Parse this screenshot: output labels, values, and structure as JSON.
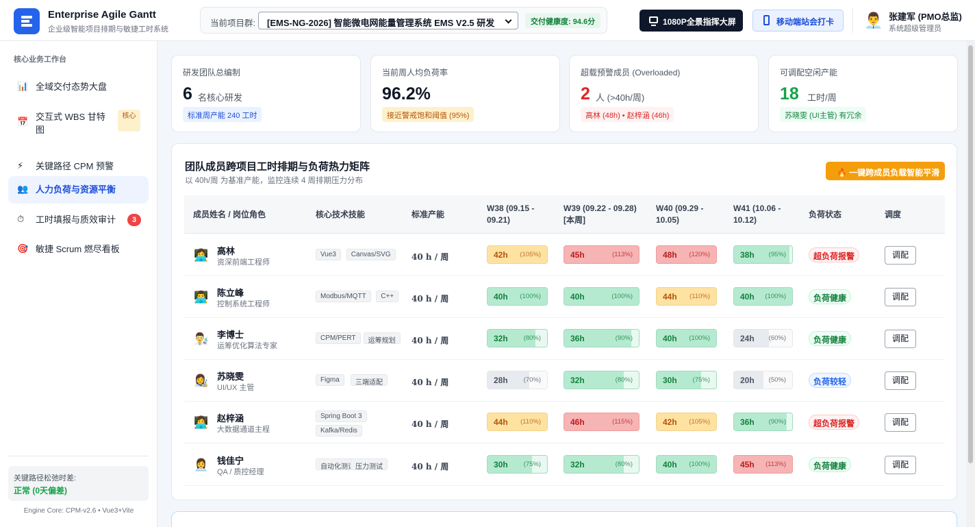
{
  "app": {
    "name": "Enterprise Agile Gantt",
    "subtitle": "企业级智能项目排期与敏捷工时系统"
  },
  "project": {
    "label": "当前项目群:",
    "selected": "[EMS-NG-2026] 智能微电网能量管理系统 EMS V2.5 研发",
    "health": "交付健康度: 94.6分"
  },
  "actions": {
    "bigscreen": "1080P全景指挥大屏",
    "mobile": "移动端站会打卡"
  },
  "user": {
    "avatar": "👨‍💼",
    "name": "张建军 (PMO总监)",
    "role": "系统超级管理员"
  },
  "sidebar": {
    "heading": "核心业务工作台",
    "items": [
      {
        "icon": "📊",
        "label": "全域交付态势大盘"
      },
      {
        "icon": "📅",
        "label": "交互式 WBS 甘特图",
        "tag": "核心"
      },
      {
        "icon": "⚡",
        "label": "关键路径 CPM 预警"
      },
      {
        "icon": "👥",
        "label": "人力负荷与资源平衡",
        "active": true
      },
      {
        "icon": "⏱",
        "label": "工时填报与质效审计",
        "badge": "3"
      },
      {
        "icon": "🎯",
        "label": "敏捷 Scrum 燃尽看板"
      }
    ],
    "slack_label": "关键路径松弛时差:",
    "slack_value": "正常 (0天偏差)",
    "engine": "Engine Core: CPM-v2.6 • Vue3+Vite"
  },
  "stats": [
    {
      "label": "研发团队总编制",
      "value": "6",
      "unit": "名核心研发",
      "badge": "标准周产能 240 工时",
      "tone": "blue"
    },
    {
      "label": "当前周人均负荷率",
      "value": "96.2%",
      "unit": "",
      "badge": "接近警戒饱和阈值 (95%)",
      "tone": "orange"
    },
    {
      "label": "超载预警成员 (Overloaded)",
      "value": "2",
      "unit": "人 (>40h/周)",
      "badge": "高林 (48h) • 赵梓涵 (46h)",
      "tone": "red"
    },
    {
      "label": "可调配空闲产能",
      "value": "18",
      "unit": "工时/周",
      "badge": "苏晓雯 (UI主管) 有冗余",
      "tone": "green"
    }
  ],
  "matrix": {
    "title": "团队成员跨项目工时排期与负荷热力矩阵",
    "subtitle": "以 40h/周 为基准产能，监控连续 4 周排期压力分布",
    "smooth_button": "🔥 一键跨成员负载智能平滑",
    "headers": {
      "member": "成员姓名 / 岗位角色",
      "skills": "核心技术技能",
      "capacity": "标准产能",
      "weeks": [
        "W38 (09.15 - 09.21)",
        "W39 (09.22 - 09.28) [本周]",
        "W40 (09.29 - 10.05)",
        "W41 (10.06 - 10.12)"
      ],
      "status": "负荷状态",
      "action": "调度"
    },
    "rows": [
      {
        "avatar": "👩‍💻",
        "name": "高林",
        "role": "资深前端工程师",
        "skills": [
          "Vue3",
          "Canvas/SVG"
        ],
        "capacity": "40 h / 周",
        "weeks": [
          {
            "h": "42h",
            "p": "(105%)",
            "pct": 105,
            "tone": "o"
          },
          {
            "h": "45h",
            "p": "(113%)",
            "pct": 113,
            "tone": "r"
          },
          {
            "h": "48h",
            "p": "(120%)",
            "pct": 120,
            "tone": "r"
          },
          {
            "h": "38h",
            "p": "(95%)",
            "pct": 95,
            "tone": "g"
          }
        ],
        "status": "超负荷报警",
        "status_tone": "r",
        "action": "调配"
      },
      {
        "avatar": "👨‍💻",
        "name": "陈立峰",
        "role": "控制系统工程师",
        "skills": [
          "Modbus/MQTT",
          "C++"
        ],
        "capacity": "40 h / 周",
        "weeks": [
          {
            "h": "40h",
            "p": "(100%)",
            "pct": 100,
            "tone": "g"
          },
          {
            "h": "40h",
            "p": "(100%)",
            "pct": 100,
            "tone": "g"
          },
          {
            "h": "44h",
            "p": "(110%)",
            "pct": 110,
            "tone": "o"
          },
          {
            "h": "40h",
            "p": "(100%)",
            "pct": 100,
            "tone": "g"
          }
        ],
        "status": "负荷健康",
        "status_tone": "g",
        "action": "调配"
      },
      {
        "avatar": "👨‍🔬",
        "name": "李博士",
        "role": "运筹优化算法专家",
        "skills": [
          "CPM/PERT",
          "运筹规划"
        ],
        "capacity": "40 h / 周",
        "weeks": [
          {
            "h": "32h",
            "p": "(80%)",
            "pct": 80,
            "tone": "g"
          },
          {
            "h": "36h",
            "p": "(90%)",
            "pct": 90,
            "tone": "g"
          },
          {
            "h": "40h",
            "p": "(100%)",
            "pct": 100,
            "tone": "g"
          },
          {
            "h": "24h",
            "p": "(60%)",
            "pct": 60,
            "tone": "n"
          }
        ],
        "status": "负荷健康",
        "status_tone": "g",
        "action": "调配"
      },
      {
        "avatar": "👩‍🎨",
        "name": "苏晓雯",
        "role": "UI/UX 主管",
        "skills": [
          "Figma",
          "三端适配"
        ],
        "capacity": "40 h / 周",
        "weeks": [
          {
            "h": "28h",
            "p": "(70%)",
            "pct": 70,
            "tone": "n"
          },
          {
            "h": "32h",
            "p": "(80%)",
            "pct": 80,
            "tone": "g"
          },
          {
            "h": "30h",
            "p": "(75%)",
            "pct": 75,
            "tone": "g"
          },
          {
            "h": "20h",
            "p": "(50%)",
            "pct": 50,
            "tone": "n"
          }
        ],
        "status": "负荷较轻",
        "status_tone": "b",
        "action": "调配"
      },
      {
        "avatar": "👩‍💻",
        "name": "赵梓涵",
        "role": "大数据通道主程",
        "skills": [
          "Spring Boot 3",
          "Kafka/Redis"
        ],
        "capacity": "40 h / 周",
        "weeks": [
          {
            "h": "44h",
            "p": "(110%)",
            "pct": 110,
            "tone": "o"
          },
          {
            "h": "46h",
            "p": "(115%)",
            "pct": 115,
            "tone": "r"
          },
          {
            "h": "42h",
            "p": "(105%)",
            "pct": 105,
            "tone": "o"
          },
          {
            "h": "36h",
            "p": "(90%)",
            "pct": 90,
            "tone": "g"
          }
        ],
        "status": "超负荷报警",
        "status_tone": "r",
        "action": "调配"
      },
      {
        "avatar": "👩‍💼",
        "name": "钱佳宁",
        "role": "QA / 质控经理",
        "skills": [
          "自动化测试",
          "压力测试"
        ],
        "capacity": "40 h / 周",
        "weeks": [
          {
            "h": "30h",
            "p": "(75%)",
            "pct": 75,
            "tone": "g"
          },
          {
            "h": "32h",
            "p": "(80%)",
            "pct": 80,
            "tone": "g"
          },
          {
            "h": "40h",
            "p": "(100%)",
            "pct": 100,
            "tone": "g"
          },
          {
            "h": "45h",
            "p": "(113%)",
            "pct": 113,
            "tone": "r"
          }
        ],
        "status": "负荷健康",
        "status_tone": "g",
        "action": "调配"
      }
    ]
  }
}
